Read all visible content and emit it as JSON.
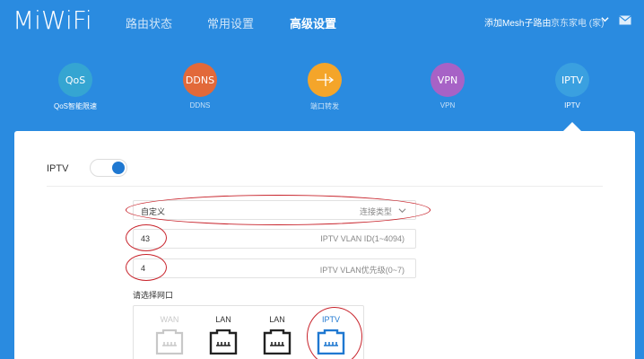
{
  "header": {
    "logo": "MiWiFi",
    "nav": [
      {
        "label": "路由状态",
        "active": false
      },
      {
        "label": "常用设置",
        "active": false
      },
      {
        "label": "高级设置",
        "active": true
      }
    ],
    "mesh_link": "添加Mesh子路由",
    "user": "京东家电 (家)",
    "icons": {
      "dropdown": "chevron-down-icon",
      "mail": "mail-icon"
    }
  },
  "features": [
    {
      "icon_text": "QoS",
      "label": "QoS智能限速",
      "color": "#35a5d2"
    },
    {
      "icon_text": "DDNS",
      "label": "DDNS",
      "color": "#e2693a"
    },
    {
      "icon_text": "",
      "label": "端口转发",
      "color": "#f4a52a"
    },
    {
      "icon_text": "VPN",
      "label": "VPN",
      "color": "#a762c6"
    },
    {
      "icon_text": "IPTV",
      "label": "IPTV",
      "color": "#3aa0e0"
    }
  ],
  "panel": {
    "iptv_label": "IPTV",
    "iptv_enabled": true,
    "connection_type": {
      "value": "自定义",
      "placeholder": "连接类型"
    },
    "vlan_id": {
      "value": "43",
      "placeholder": "IPTV VLAN ID(1~4094)"
    },
    "vlan_priority": {
      "value": "4",
      "placeholder": "IPTV VLAN优先级(0~7)"
    },
    "port_title": "请选择网口",
    "ports": [
      {
        "label": "WAN",
        "state": "disabled",
        "color": "#c8c8c8"
      },
      {
        "label": "LAN",
        "state": "normal",
        "color": "#222222"
      },
      {
        "label": "LAN",
        "state": "normal",
        "color": "#222222"
      },
      {
        "label": "IPTV",
        "state": "selected",
        "color": "#1f78d1"
      }
    ],
    "annotation_color": "#c8242c"
  }
}
